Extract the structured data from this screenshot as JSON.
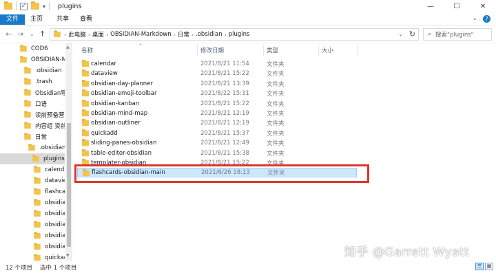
{
  "window": {
    "title": "plugins",
    "minimize": "—",
    "maximize": "☐",
    "close": "✕"
  },
  "ribbon": {
    "tabs": [
      "文件",
      "主页",
      "共享",
      "查看"
    ],
    "expand": "⌄",
    "help": "?"
  },
  "nav": {
    "back": "←",
    "forward": "→",
    "recent": "⌄",
    "up": "↑"
  },
  "address": {
    "crumbs": [
      "此电脑",
      "桌面",
      "OBSIDIAN-Markdown",
      "日常",
      ".obsidian",
      "plugins"
    ],
    "chevron": "›",
    "dropdown": "⌄",
    "refresh": "↻"
  },
  "search": {
    "placeholder": "搜索\"plugins\"",
    "icon": "⌕"
  },
  "sidebar": {
    "items": [
      {
        "label": "COD6",
        "indent": 1
      },
      {
        "label": "OBSIDIAN-Ma",
        "indent": 1
      },
      {
        "label": ".obsidian",
        "indent": 2
      },
      {
        "label": ".trash",
        "indent": 2
      },
      {
        "label": "Obsidian导出",
        "indent": 2
      },
      {
        "label": "口语",
        "indent": 2
      },
      {
        "label": "读前预备营",
        "indent": 2
      },
      {
        "label": "内容组 资前",
        "indent": 2
      },
      {
        "label": "日常",
        "indent": 2
      },
      {
        "label": ".obsidian",
        "indent": 3
      },
      {
        "label": "plugins",
        "indent": 4
      },
      {
        "label": "calendar",
        "indent": 5
      },
      {
        "label": "dataview",
        "indent": 5
      },
      {
        "label": "flashcard",
        "indent": 5
      },
      {
        "label": "obsidian",
        "indent": 5
      },
      {
        "label": "obsidian",
        "indent": 5
      },
      {
        "label": "obsidian",
        "indent": 5
      },
      {
        "label": "obsidian",
        "indent": 5
      },
      {
        "label": "obsidian",
        "indent": 5
      },
      {
        "label": "quickadd",
        "indent": 5
      }
    ],
    "selected_index": 10
  },
  "columns": {
    "name": "名称",
    "date": "修改日期",
    "type": "类型",
    "size": "大小",
    "sort_indicator": "^"
  },
  "files": [
    {
      "name": "calendar",
      "date": "2021/8/21 11:54",
      "type": "文件夹"
    },
    {
      "name": "dataview",
      "date": "2021/8/21 15:22",
      "type": "文件夹"
    },
    {
      "name": "obsidian-day-planner",
      "date": "2021/8/21 13:39",
      "type": "文件夹"
    },
    {
      "name": "obsidian-emoji-toolbar",
      "date": "2021/8/22 15:31",
      "type": "文件夹"
    },
    {
      "name": "obsidian-kanban",
      "date": "2021/8/21 15:22",
      "type": "文件夹"
    },
    {
      "name": "obsidian-mind-map",
      "date": "2021/8/21 12:19",
      "type": "文件夹"
    },
    {
      "name": "obsidian-outliner",
      "date": "2021/8/21 12:19",
      "type": "文件夹"
    },
    {
      "name": "quickadd",
      "date": "2021/8/21 15:37",
      "type": "文件夹"
    },
    {
      "name": "sliding-panes-obsidian",
      "date": "2021/8/21 12:49",
      "type": "文件夹"
    },
    {
      "name": "table-editor-obsidian",
      "date": "2021/8/21 15:38",
      "type": "文件夹"
    },
    {
      "name": "templater-obsidian",
      "date": "2021/8/21 15:22",
      "type": "文件夹"
    },
    {
      "name": "flashcards-obsidian-main",
      "date": "2021/6/26 18:13",
      "type": "文件夹"
    }
  ],
  "selected_file_index": 11,
  "status": {
    "count": "12 个项目",
    "selected": "选中 1 个项目"
  },
  "watermark": "知乎 @Garrett Wyatt",
  "colors": {
    "accent": "#1979ca",
    "selection": "#cce8ff",
    "highlight_box": "#e0342f",
    "folder": "#f3c34c"
  }
}
